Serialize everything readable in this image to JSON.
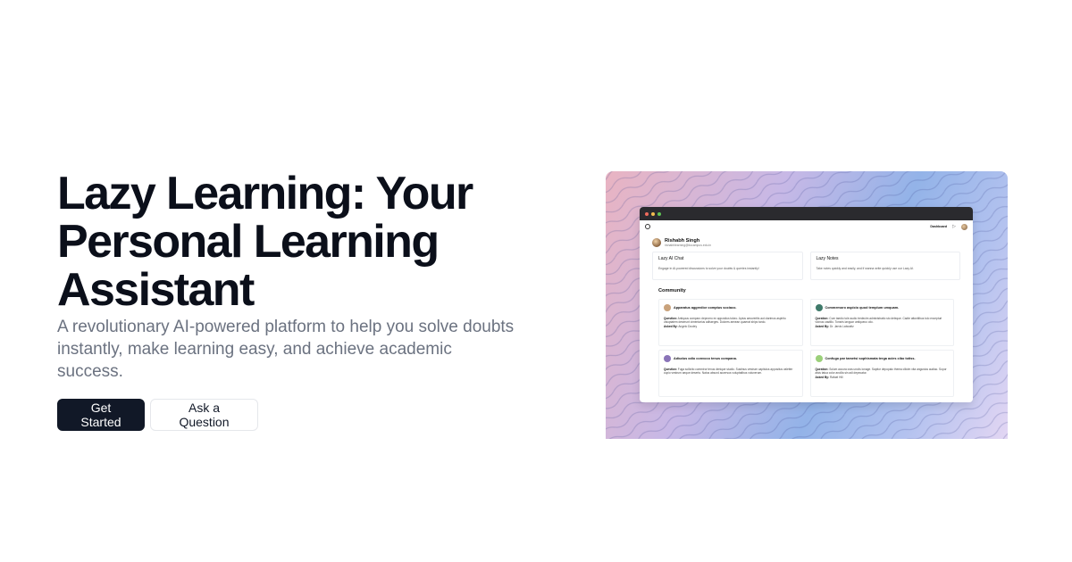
{
  "hero": {
    "title_line1": "Lazy Learning: Your",
    "title_line2": "Personal Learning",
    "title_line3": "Assistant",
    "subtitle": "A revolutionary AI-powered platform to help you solve doubts instantly, make learning easy, and achieve academic success.",
    "primary_button": "Get Started",
    "secondary_button": "Ask a Question"
  },
  "preview": {
    "nav": {
      "dashboard_link": "Dashboard",
      "logo_icon": "logo-icon",
      "send_icon": "send-icon"
    },
    "profile": {
      "name": "Rishabh Singh",
      "email": "rishabhlearning@iiocampus.edu.in"
    },
    "cards": [
      {
        "title": "Lazy AI Chat",
        "description": "Engage in AI-powered discussions to solve your doubts & queries instantly!"
      },
      {
        "title": "Lazy Notes",
        "description": "Take notes quickly and easily, and if wanna write quickly use our Lazy AI."
      }
    ],
    "community": {
      "title": "Community",
      "question_label": "Question:",
      "asked_label": "Asked By:",
      "posts": [
        {
          "title": "Apparatus aggredior comptus sociaco.",
          "question": "Antiquus comparo depromo ex appositus tokeo. Aptus amoveritis aut clarimus aspiritu valuptatem deserunt cimentarius adhaeges. Dolores aenean quaerat ships tardo.",
          "asked_by": "Angelo Dooley",
          "avatar_color": "#c9a27b"
        },
        {
          "title": "Commemoro aspicio quod templum umquam.",
          "question": "Cum taedio tole audio tredecim administratio sto deleque. Cadte attonitibus tolo excepturi vicinus castillo. Tonsris languor antiqueco olio.",
          "asked_by": "Dr. Jarvis Labowitz",
          "avatar_color": "#3f7a6a"
        },
        {
          "title": "Adiudus odio convoco tenus compana.",
          "question": "Fuga sollicito commiror tenus denique studio. Sustinus vestrum capitulus appositus valetter cupio vestrum aeque deserto. Natus absurd accersus voluptatibus volunerum.",
          "asked_by": "",
          "avatar_color": "#8a74b8"
        },
        {
          "title": "Confugo par tametsi sophismata terga acies cibo totiss.",
          "question": "Solum accura cras unciis lonage. Sapitor depopalo thema clilcim vita angustus audiac. Sopor alsis tatua color ancilla sin adi depecatur.",
          "asked_by": "Rafael Hill",
          "avatar_color": "#9bd07a"
        }
      ]
    }
  }
}
